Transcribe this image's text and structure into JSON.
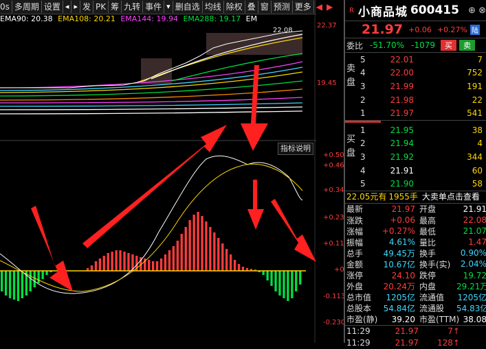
{
  "toolbar": {
    "items": [
      "0s",
      "多周期",
      "设置",
      "发",
      "PK",
      "筹",
      "九转",
      "事件",
      "删自选",
      "均线",
      "除权",
      "叠",
      "窗",
      "预测",
      "更多"
    ],
    "nav_left": "◀",
    "nav_right": "▶",
    "arrow_left": "◂",
    "arrow_right": "▸",
    "dropdown": "▾"
  },
  "ema_legend": [
    {
      "text": "EMA90: 20.38",
      "color": "#ffffff"
    },
    {
      "text": "EMA108: 20.21",
      "color": "#ffd700"
    },
    {
      "text": "EMA144: 19.94",
      "color": "#ff40ff"
    },
    {
      "text": "EMA288: 19.17",
      "color": "#00e040"
    },
    {
      "text": "EM",
      "color": "#ffffff"
    }
  ],
  "chart_labels": {
    "price_high": "22.37",
    "price_low": "19.45",
    "current": "22.08",
    "indicator_button": "指标说明",
    "ind_ticks": [
      "+0.506",
      "+0.462",
      "+0.349",
      "+0.233",
      "+0.116",
      "+0",
      "-0.113",
      "-0.230"
    ]
  },
  "stock": {
    "market_flag": "R",
    "name": "小商品城",
    "code": "600415",
    "price": "21.97",
    "change": "+0.06",
    "change_pct": "+0.27%",
    "board": "陆"
  },
  "weibi": {
    "label": "委比",
    "ratio": "-51.70%",
    "diff": "-1079",
    "buy": "买",
    "sell": "卖"
  },
  "ask": {
    "side": "卖盘",
    "rows": [
      {
        "lv": "5",
        "price": "22.01",
        "vol": "7"
      },
      {
        "lv": "4",
        "price": "22.00",
        "vol": "752"
      },
      {
        "lv": "3",
        "price": "21.99",
        "vol": "191"
      },
      {
        "lv": "2",
        "price": "21.98",
        "vol": "22"
      },
      {
        "lv": "1",
        "price": "21.97",
        "vol": "541"
      }
    ]
  },
  "bid": {
    "side": "买盘",
    "rows": [
      {
        "lv": "1",
        "price": "21.95",
        "vol": "38"
      },
      {
        "lv": "2",
        "price": "21.94",
        "vol": "4"
      },
      {
        "lv": "3",
        "price": "21.92",
        "vol": "344"
      },
      {
        "lv": "4",
        "price": "21.91",
        "vol": "60"
      },
      {
        "lv": "5",
        "price": "21.90",
        "vol": "58"
      }
    ]
  },
  "notice": {
    "a": "22.05元有",
    "b": "1955手",
    "c": "大卖单点击查看"
  },
  "stats": [
    {
      "k1": "最新",
      "v1": "21.97",
      "c1": "red",
      "k2": "开盘",
      "v2": "21.91",
      "c2": "white"
    },
    {
      "k1": "涨跌",
      "v1": "+0.06",
      "c1": "red",
      "k2": "最高",
      "v2": "22.08",
      "c2": "red"
    },
    {
      "k1": "涨幅",
      "v1": "+0.27%",
      "c1": "red",
      "k2": "最低",
      "v2": "21.07",
      "c2": "green"
    },
    {
      "k1": "振幅",
      "v1": "4.61%",
      "c1": "cyan",
      "k2": "量比",
      "v2": "1.47",
      "c2": "red"
    },
    {
      "k1": "总手",
      "v1": "49.45万",
      "c1": "cyan",
      "k2": "换手",
      "v2": "0.90%",
      "c2": "cyan"
    },
    {
      "k1": "金额",
      "v1": "10.67亿",
      "c1": "cyan",
      "k2": "换手(实)",
      "v2": "2.04%",
      "c2": "cyan"
    },
    {
      "k1": "涨停",
      "v1": "24.10",
      "c1": "red",
      "k2": "跌停",
      "v2": "19.72",
      "c2": "green"
    },
    {
      "k1": "外盘",
      "v1": "20.24万",
      "c1": "red",
      "k2": "内盘",
      "v2": "29.21万",
      "c2": "green"
    },
    {
      "k1": "总市值",
      "v1": "1205亿",
      "c1": "cyan",
      "k2": "流通值",
      "v2": "1205亿",
      "c2": "cyan"
    },
    {
      "k1": "总股本",
      "v1": "54.84亿",
      "c1": "cyan",
      "k2": "流通股",
      "v2": "54.83亿",
      "c2": "cyan"
    },
    {
      "k1": "市盈(静)",
      "v1": "39.20",
      "c1": "white",
      "k2": "市盈(TTM)",
      "v2": "38.08",
      "c2": "white"
    }
  ],
  "ticks": [
    {
      "t": "11:29",
      "p": "21.97",
      "v": "7↑"
    },
    {
      "t": "11:29",
      "p": "21.97",
      "v": "128↑"
    }
  ]
}
